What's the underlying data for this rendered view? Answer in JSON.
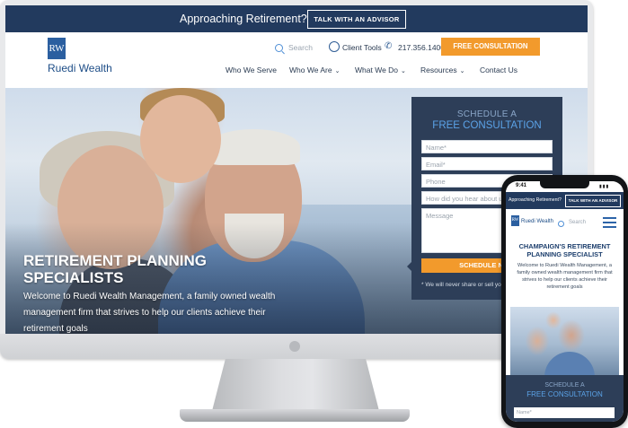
{
  "desktop": {
    "topbar": {
      "tagline": "Approaching Retirement?",
      "advisor_button": "TALK WITH AN ADVISOR"
    },
    "header": {
      "logo_mark": "RW",
      "logo_text": "Ruedi Wealth",
      "search_placeholder": "Search",
      "client_tools": "Client Tools",
      "phone": "217.356.1400",
      "consultation_button": "FREE CONSULTATION",
      "nav": [
        {
          "label": "Who We Serve",
          "has_dropdown": false
        },
        {
          "label": "Who We Are",
          "has_dropdown": true
        },
        {
          "label": "What We Do",
          "has_dropdown": true
        },
        {
          "label": "Resources",
          "has_dropdown": true
        },
        {
          "label": "Contact Us",
          "has_dropdown": false
        }
      ]
    },
    "hero": {
      "title": "RETIREMENT PLANNING SPECIALISTS",
      "subtitle": "Welcome to Ruedi Wealth Management, a family owned wealth management firm that strives to help our clients achieve their retirement goals"
    },
    "form": {
      "heading_line1": "SCHEDULE A",
      "heading_line2": "FREE CONSULTATION",
      "fields": [
        "Name*",
        "Email*",
        "Phone",
        "How did you hear about us?",
        "Message"
      ],
      "submit": "SCHEDULE NOW",
      "privacy": "* We will never share or sell your information"
    }
  },
  "mobile": {
    "status_time": "9:41",
    "topbar": {
      "tagline": "Approaching Retirement?",
      "advisor_button": "TALK WITH AN ADVISOR"
    },
    "logo_mark": "RW",
    "logo_text": "Ruedi Wealth",
    "search_placeholder": "Search",
    "heading": "CHAMPAIGN'S RETIREMENT PLANNING SPECIALIST",
    "body": "Welcome to Ruedi Wealth Management, a family owned wealth management firm that strives to help our clients achieve their retirement goals",
    "form": {
      "heading_line1": "SCHEDULE A",
      "heading_line2": "FREE CONSULTATION",
      "name_placeholder": "Name*"
    }
  },
  "colors": {
    "navy": "#223a5e",
    "form_bg": "#2d3e58",
    "accent_orange": "#f29a2c",
    "accent_blue": "#5ba3e8"
  },
  "icons": [
    "search-icon",
    "user-icon",
    "phone-icon",
    "chevron-down-icon",
    "hamburger-menu-icon",
    "apple-logo-icon"
  ]
}
